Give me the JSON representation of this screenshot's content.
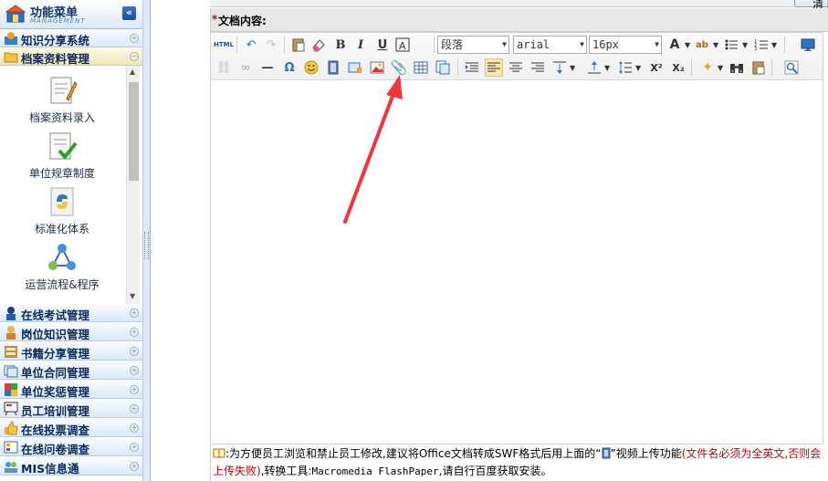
{
  "sidebar": {
    "title": "功能菜单",
    "subtitle": "MANAGEMENT",
    "collapse_glyph": "«",
    "menus_top": [
      {
        "label": "知识分享系统",
        "toggle": "+"
      },
      {
        "label": "档案资料管理",
        "toggle": "−"
      }
    ],
    "sub_items": [
      {
        "label": "档案资料录入"
      },
      {
        "label": "单位规章制度"
      },
      {
        "label": "标准化体系"
      },
      {
        "label": "运营流程&程序"
      }
    ],
    "menus_bottom": [
      {
        "label": "在线考试管理",
        "toggle": "+"
      },
      {
        "label": "岗位知识管理",
        "toggle": "+"
      },
      {
        "label": "书籍分享管理",
        "toggle": "+"
      },
      {
        "label": "单位合同管理",
        "toggle": "+"
      },
      {
        "label": "单位奖惩管理",
        "toggle": "+"
      },
      {
        "label": "员工培训管理",
        "toggle": "+"
      },
      {
        "label": "在线投票调查",
        "toggle": "+"
      },
      {
        "label": "在线问卷调查",
        "toggle": "+"
      },
      {
        "label": "MIS信息通",
        "toggle": "+"
      }
    ]
  },
  "form": {
    "reset_label": "清 除",
    "required_mark": "*",
    "field_label": "文档内容:"
  },
  "toolbar": {
    "html_label": "HTML",
    "bold": "B",
    "italic": "I",
    "underline": "U",
    "paragraph_select": "段落",
    "font_select": "arial",
    "size_select": "16px",
    "omega": "Ω",
    "superscript": "X²",
    "subscript": "X₂"
  },
  "notice": {
    "prefix": ":为方便员工浏览和禁止员工修改,建议将Office文档转成SWF格式后用上面的“",
    "middle": "”视频上传功能",
    "warn": "(文件名必须为全英文,否则会上传失败)",
    "suffix_before": ",转换工具:",
    "tool_name": "Macromedia FlashPaper",
    "suffix_after": ",请自行百度获取安装。"
  },
  "colors": {
    "accent_arrow": "#f0353b",
    "menu_text": "#0b2a5c",
    "warn_text": "#c00000"
  }
}
